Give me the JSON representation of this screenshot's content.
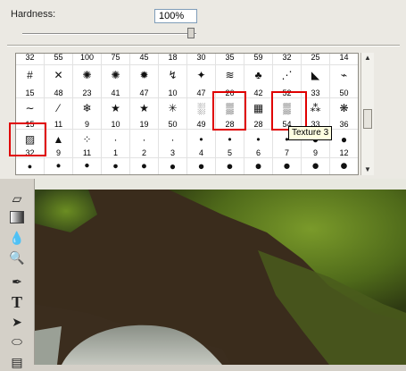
{
  "hardness": {
    "label": "Hardness:",
    "value": "100%",
    "slider_value_percent": 100
  },
  "brush_grid": {
    "row1": [
      "32",
      "55",
      "100",
      "75",
      "45",
      "18",
      "30",
      "35",
      "59",
      "32",
      "25",
      "14"
    ],
    "row2": [
      {
        "n": "15",
        "icon": "#"
      },
      {
        "n": "48",
        "icon": "✕"
      },
      {
        "n": "23",
        "icon": "✺"
      },
      {
        "n": "41",
        "icon": "✺"
      },
      {
        "n": "47",
        "icon": "✹"
      },
      {
        "n": "10",
        "icon": "↯"
      },
      {
        "n": "47",
        "icon": "✦"
      },
      {
        "n": "26",
        "icon": "≋"
      },
      {
        "n": "42",
        "icon": "♣"
      },
      {
        "n": "52",
        "icon": "⋰"
      },
      {
        "n": "33",
        "icon": "◣"
      },
      {
        "n": "50",
        "icon": "⌁"
      }
    ],
    "row3": [
      {
        "n": "15",
        "icon": "∼"
      },
      {
        "n": "11",
        "icon": "⁄"
      },
      {
        "n": "9",
        "icon": "❄"
      },
      {
        "n": "10",
        "icon": "★"
      },
      {
        "n": "19",
        "icon": "★"
      },
      {
        "n": "50",
        "icon": "✳"
      },
      {
        "n": "49",
        "icon": "░"
      },
      {
        "n": "28",
        "icon": "▒"
      },
      {
        "n": "28",
        "icon": "▦"
      },
      {
        "n": "54",
        "icon": "▒"
      },
      {
        "n": "33",
        "icon": "⁂"
      },
      {
        "n": "36",
        "icon": "❋"
      }
    ],
    "row4": [
      {
        "n": "32",
        "icon": "▨"
      },
      {
        "n": "9",
        "icon": "▲"
      },
      {
        "n": "11",
        "icon": "⁘"
      },
      {
        "n": "1",
        "icon": "·"
      },
      {
        "n": "2",
        "icon": "·"
      },
      {
        "n": "3",
        "icon": "·"
      },
      {
        "n": "4",
        "icon": "•"
      },
      {
        "n": "5",
        "icon": "•"
      },
      {
        "n": "6",
        "icon": "•"
      },
      {
        "n": "7",
        "icon": "•"
      },
      {
        "n": "9",
        "icon": "●"
      },
      {
        "n": "12",
        "icon": "●"
      }
    ],
    "row5": [
      "●",
      "●",
      "●",
      "●",
      "●",
      "●",
      "●",
      "●",
      "●",
      "●",
      "●",
      "●"
    ]
  },
  "tooltip": "Texture 3",
  "highlight_color": "#e00000",
  "tools": [
    "eraser-icon",
    "gradient-icon",
    "blur-drop-icon",
    "dodge-icon",
    "pen-icon",
    "type-icon",
    "path-select-icon",
    "ellipse-icon",
    "notes-icon"
  ]
}
